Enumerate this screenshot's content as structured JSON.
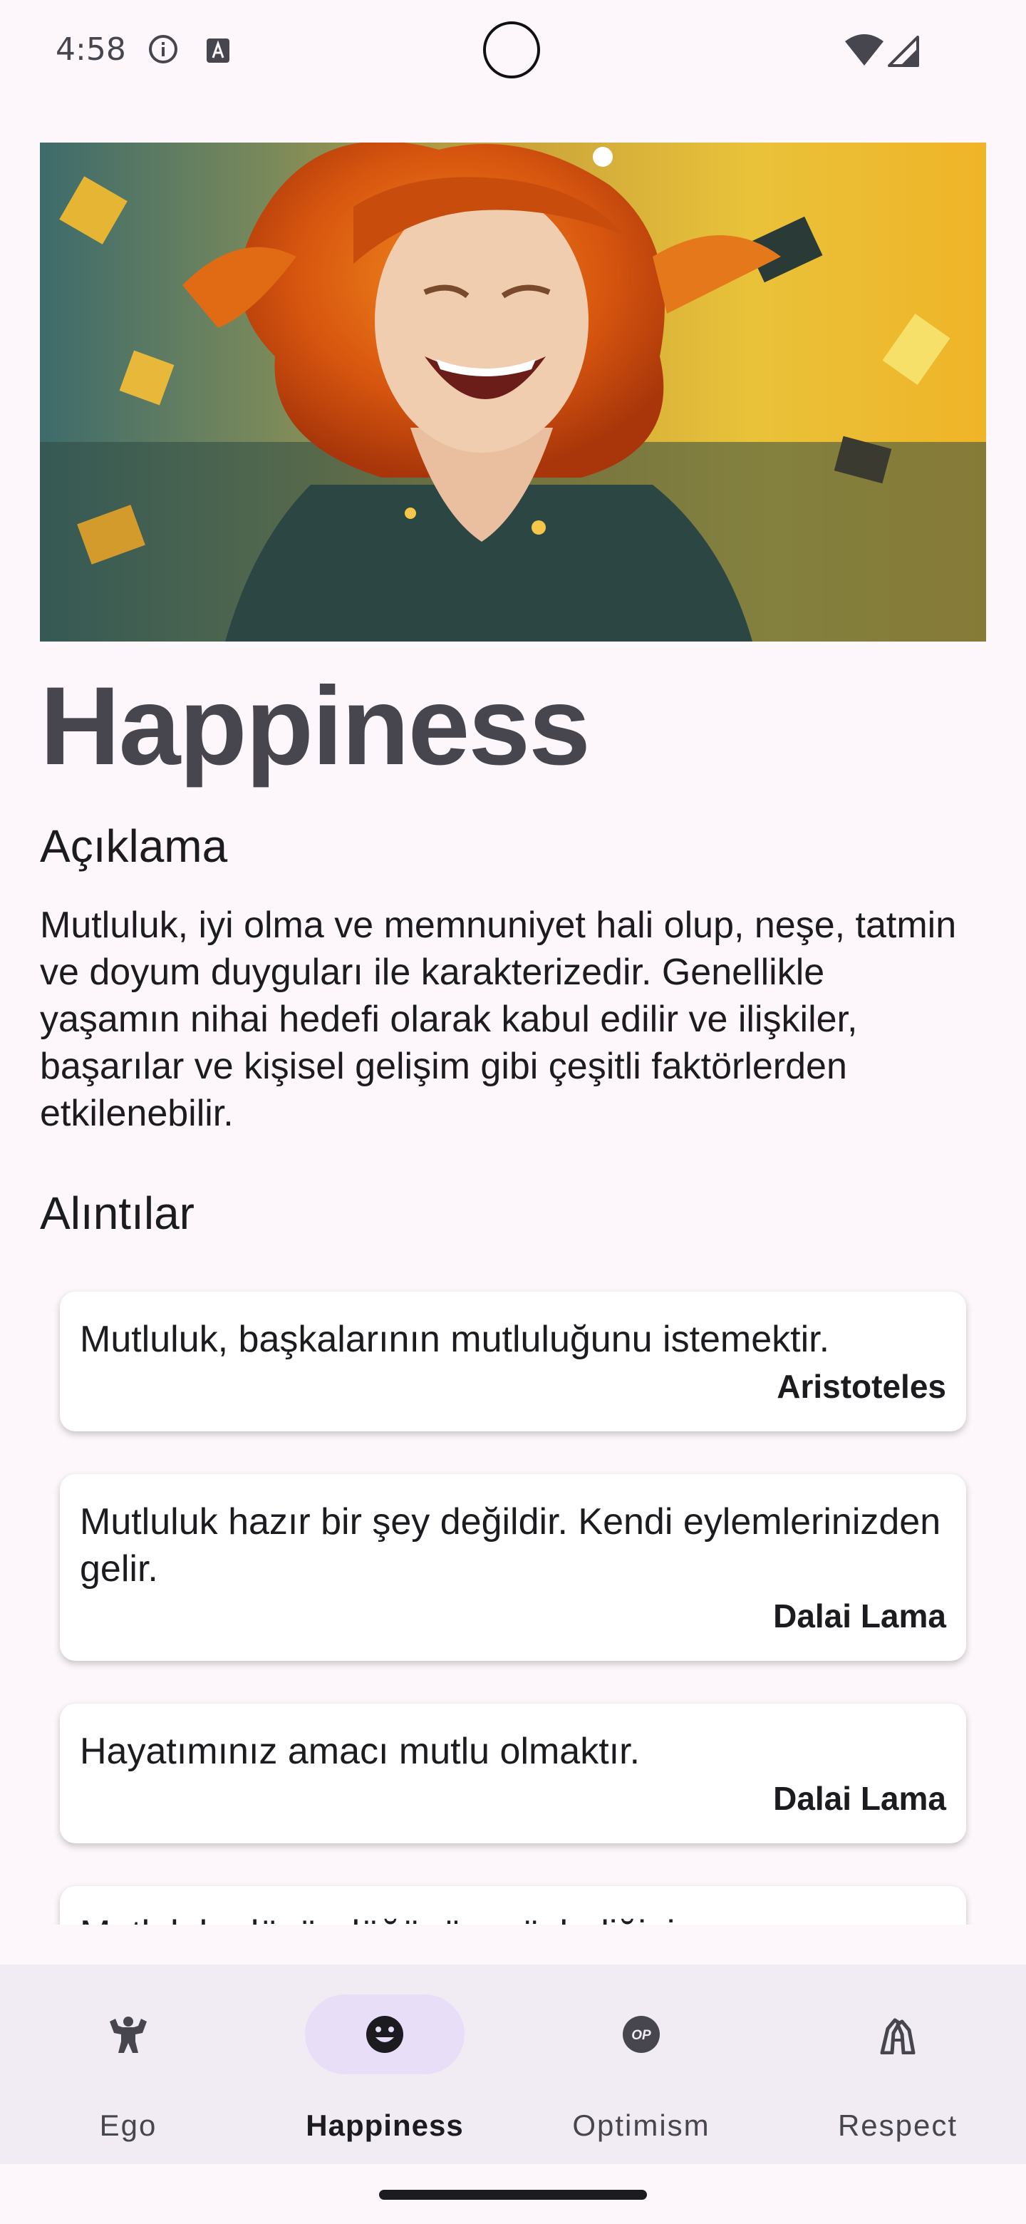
{
  "status_bar": {
    "time": "4:58",
    "icons": [
      "info-icon",
      "text-a-icon",
      "camera-cutout",
      "wifi-icon",
      "signal-icon"
    ]
  },
  "hero": {
    "image": "laughing-woman-red-hair-abstract-illustration"
  },
  "title": "Happiness",
  "description_heading": "Açıklama",
  "description": "Mutluluk, iyi olma ve memnuniyet hali olup, neşe, tatmin ve doyum duyguları ile karakterizedir. Genellikle yaşamın nihai hedefi olarak kabul edilir ve ilişkiler, başarılar ve kişisel gelişim gibi çeşitli faktörlerden etkilenebilir.",
  "quotes_heading": "Alıntılar",
  "quotes": [
    {
      "text": "Mutluluk, başkalarının mutluluğunu istemektir.",
      "author": "Aristoteles"
    },
    {
      "text": "Mutluluk hazır bir şey değildir. Kendi eylemlerinizden gelir.",
      "author": "Dalai Lama"
    },
    {
      "text": "Hayatımınız amacı mutlu olmaktır.",
      "author": "Dalai Lama"
    },
    {
      "text": "Mutluluk, düşündüğünüz, söylediğiniz ve",
      "author": ""
    }
  ],
  "nav": {
    "items": [
      {
        "label": "Ego",
        "icon": "ego-strongman-icon",
        "active": false
      },
      {
        "label": "Happiness",
        "icon": "smiley-icon",
        "active": true
      },
      {
        "label": "Optimism",
        "icon": "op-badge-icon",
        "op_text": "OP",
        "active": false
      },
      {
        "label": "Respect",
        "icon": "respect-icon",
        "active": false
      }
    ]
  },
  "colors": {
    "background": "#fdf7fc",
    "nav_background": "#f1ecf4",
    "active_pill": "#e8def8",
    "title": "#47464f"
  }
}
